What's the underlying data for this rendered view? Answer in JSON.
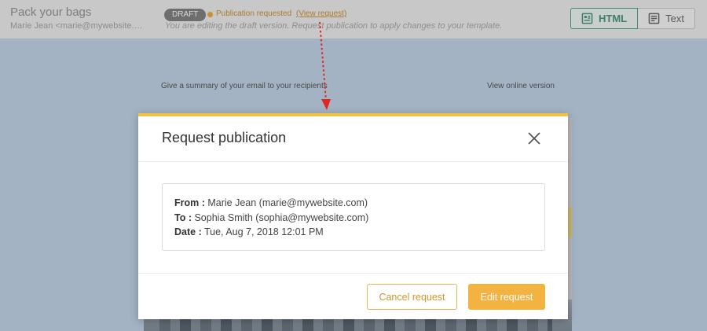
{
  "topbar": {
    "campaign_title": "Pack your bags",
    "sender": "Marie Jean <marie@mywebsite.com>",
    "draft_badge": "DRAFT",
    "publication_status": "Publication requested",
    "view_request_link": "(View request)",
    "note": "You are editing the draft version. Request publication to apply changes to your template.",
    "status_color": "#c8902f"
  },
  "view_toggle": {
    "html_label": "HTML",
    "text_label": "Text",
    "active": "HTML",
    "html_icon": "layout-icon",
    "text_icon": "document-lines-icon"
  },
  "canvas": {
    "summary_text": "Give a summary of your email to your recipients",
    "online_link": "View online version"
  },
  "modal": {
    "title": "Request publication",
    "accent_color": "#f2c13e",
    "from_label": "From :",
    "from_value": "Marie Jean (marie@mywebsite.com)",
    "to_label": "To :",
    "to_value": "Sophia Smith (sophia@mywebsite.com)",
    "date_label": "Date :",
    "date_value": "Tue, Aug 7, 2018 12:01 PM",
    "cancel_label": "Cancel request",
    "edit_label": "Edit request",
    "close_icon": "close-icon"
  },
  "annotation": {
    "arrow_color": "#e0261e"
  }
}
